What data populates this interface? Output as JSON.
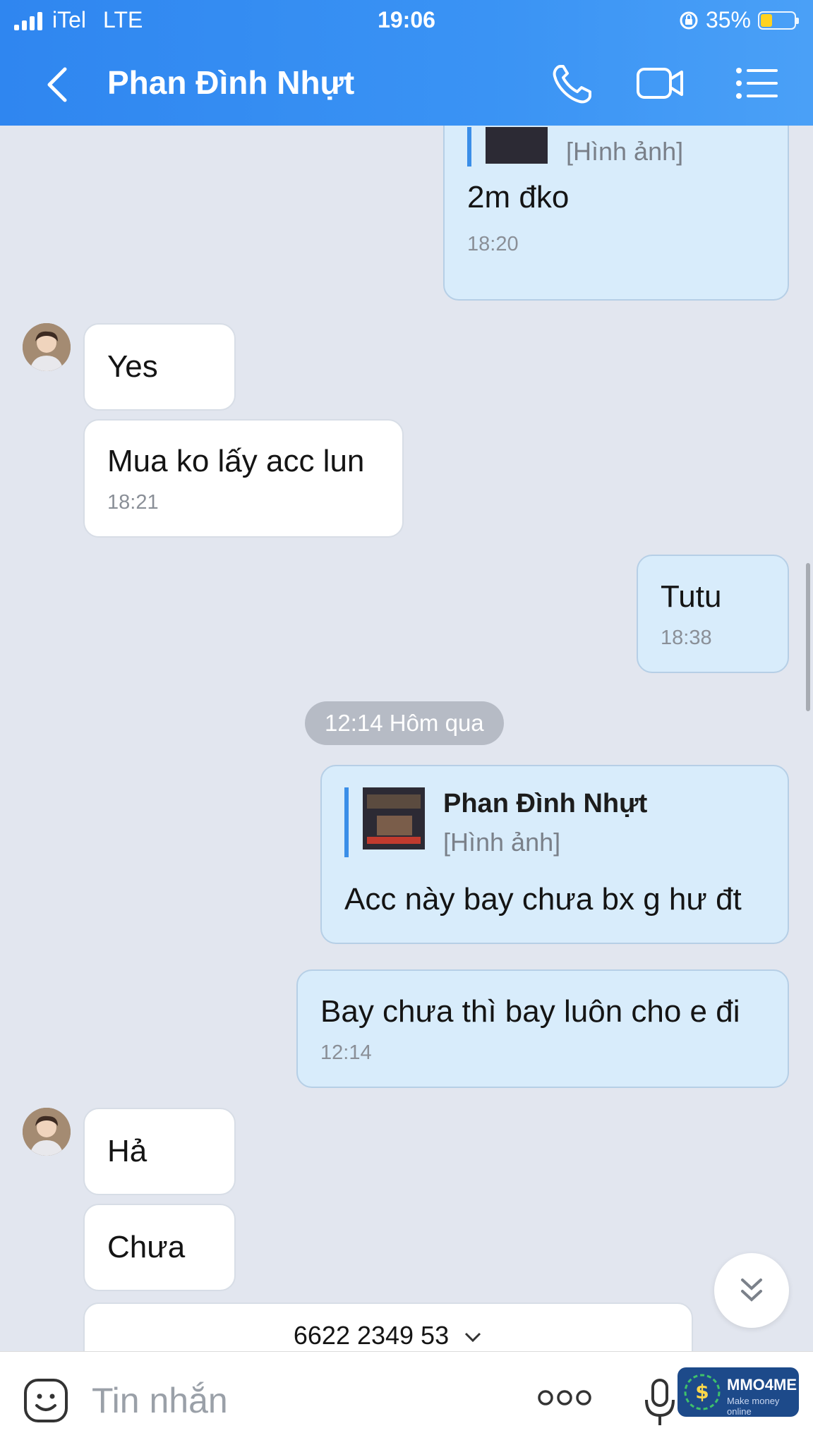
{
  "status_bar": {
    "carrier": "iTel",
    "network": "LTE",
    "time": "19:06",
    "battery": "35%"
  },
  "header": {
    "contact_name": "Phan Đình Nhựt"
  },
  "colors": {
    "header": "#3a8ff2",
    "outgoing": "#d8ecfb",
    "incoming": "#ffffff",
    "background": "#e2e6ef"
  },
  "messages": [
    {
      "id": "m1",
      "from": "me",
      "quote_sub": "[Hình ảnh]",
      "text": "2m đko",
      "time": "18:20"
    },
    {
      "id": "m2",
      "from": "them",
      "text": "Yes"
    },
    {
      "id": "m3",
      "from": "them",
      "text": "Mua ko lấy acc lun",
      "time": "18:21"
    },
    {
      "id": "m4",
      "from": "me",
      "text": "Tutu",
      "time": "18:38"
    },
    {
      "id": "m5",
      "from": "me",
      "quote_name": "Phan Đình Nhựt",
      "quote_sub": "[Hình ảnh]",
      "text": "Acc này bay chưa bx g hư đt"
    },
    {
      "id": "m6",
      "from": "me",
      "text": "Bay chưa thì bay luôn cho e đi",
      "time": "12:14"
    },
    {
      "id": "m7",
      "from": "them",
      "text": "Hả"
    },
    {
      "id": "m8",
      "from": "them",
      "text": "Chưa"
    }
  ],
  "date_divider": "12:14 Hôm qua",
  "phone_card": {
    "number": "6622 2349 53"
  },
  "composer": {
    "placeholder": "Tin nhắn"
  },
  "watermark": {
    "brand": "MMO4ME",
    "tagline": "Make money online"
  }
}
